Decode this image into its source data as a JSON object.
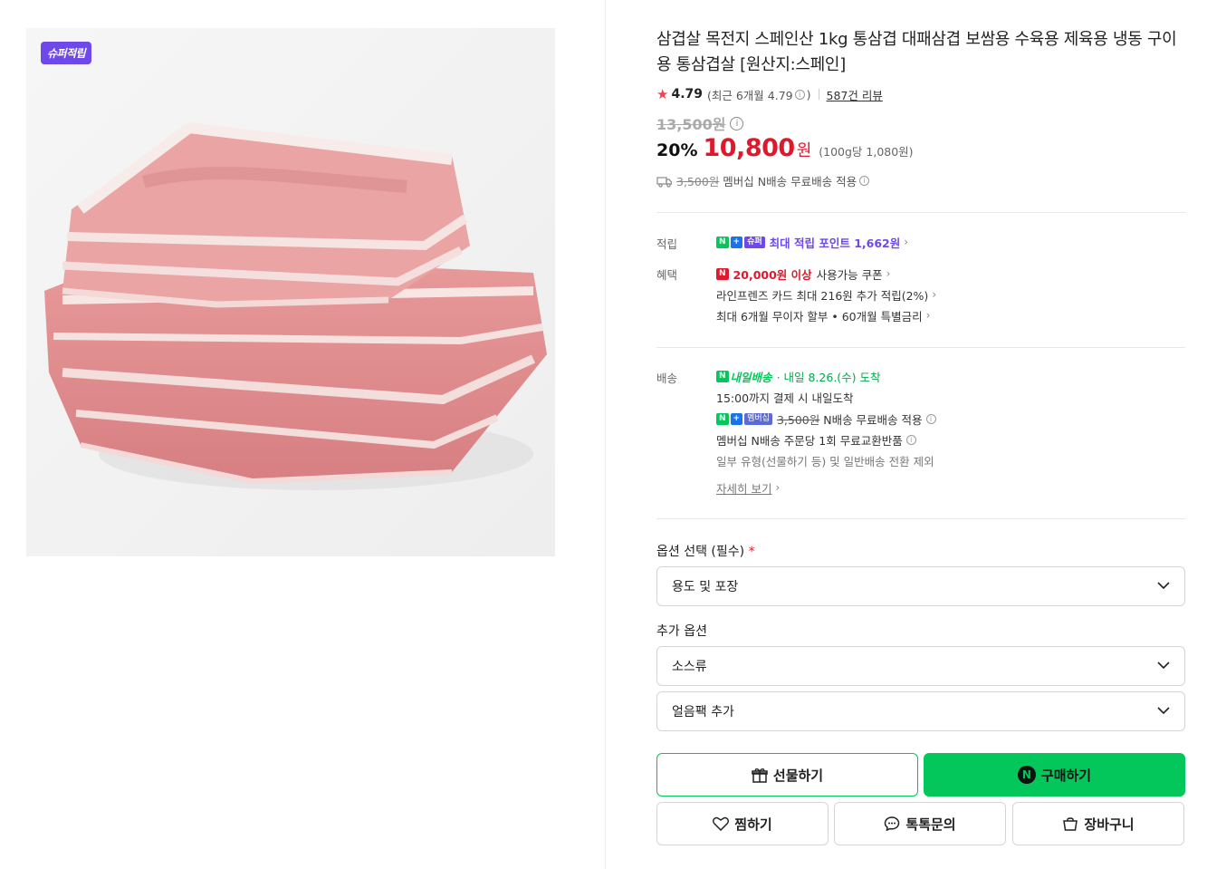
{
  "product": {
    "badge": "슈퍼적립",
    "image_alt": "통삼겹살 두 덩어리",
    "title": "삼겹살 목전지 스페인산 1kg 통삼겹 대패삼겹 보쌈용 수육용 제육용 냉동 구이용 통삼겹살 [원산지:스페인]"
  },
  "rating": {
    "star": "★",
    "score": "4.79",
    "recent_prefix": "(최근 6개월 4.79",
    "recent_suffix": ")",
    "reviews": "587건 리뷰"
  },
  "price": {
    "original": "13,500원",
    "discount": "20%",
    "sale": "10,800",
    "currency": "원",
    "unit": "(100g당 1,080원)"
  },
  "shipping_summary": {
    "strike_fee": "3,500원",
    "text": "멤버십 N배송 무료배송 적용"
  },
  "benefits": {
    "points_label": "적립",
    "points_tags": [
      "N",
      "+",
      "슈퍼"
    ],
    "points_text": "최대 적립 포인트 1,662원",
    "benefit_label": "혜택",
    "coupon_tag": "N",
    "coupon_highlight": "20,000원 이상",
    "coupon_text": "사용가능 쿠폰",
    "card_text": "라인프렌즈 카드 최대 216원 추가 적립(2%)",
    "installment_text": "최대 6개월 무이자 할부 • 60개월 특별금리"
  },
  "delivery": {
    "label": "배송",
    "logo_text": "내일배송",
    "arrival": "· 내일 8.26.(수) 도착",
    "cutoff": "15:00까지 결제 시 내일도착",
    "member_tag_n": "N",
    "member_tag_plus": "+",
    "member_tag": "멤버십",
    "member_strike": "3,500원",
    "member_text": "N배송 무료배송 적용",
    "exchange": "멤버십 N배송 주문당 1회 무료교환반품",
    "exclusion": "일부 유형(선물하기 등) 및 일반배송 전환 제외",
    "details_link": "자세히 보기"
  },
  "options": {
    "required_label": "옵션 선택 (필수)",
    "required_mark": "*",
    "required_select": "용도 및 포장",
    "extra_label": "추가 옵션",
    "extra_selects": [
      "소스류",
      "얼음팩 추가"
    ]
  },
  "buttons": {
    "gift": "선물하기",
    "buy": "구매하기",
    "wish": "찜하기",
    "talk": "톡톡문의",
    "cart": "장바구니"
  },
  "colors": {
    "accent_green": "#03c75a",
    "sale_red": "#e0182d",
    "super_purple": "#6f48ea"
  }
}
